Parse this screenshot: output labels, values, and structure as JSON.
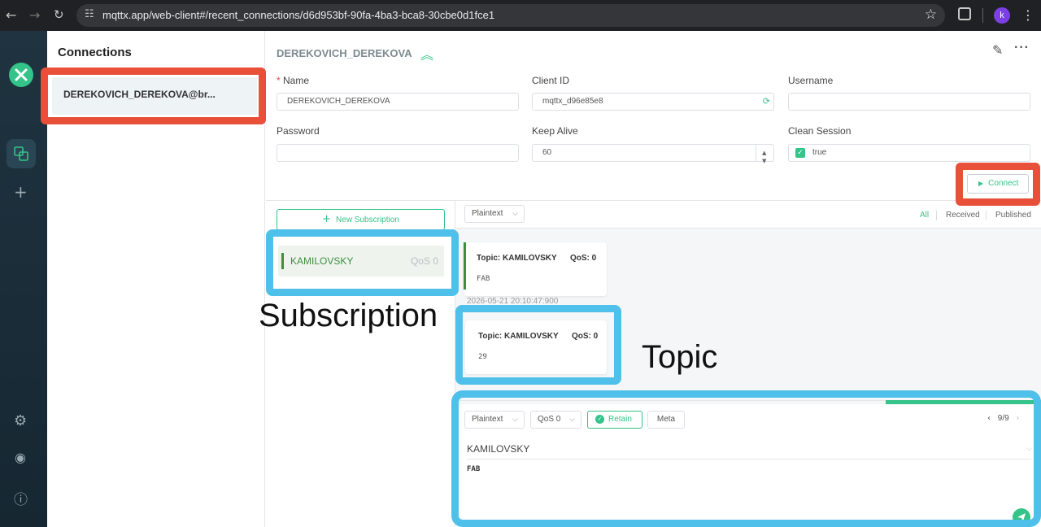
{
  "browser": {
    "url": "mqttx.app/web-client#/recent_connections/d6d953bf-90fa-4ba3-bca8-30cbe0d1fce1",
    "profile_initial": "k"
  },
  "sidebar": {
    "title": "Connections",
    "connection_item": "DEREKOVICH_DEREKOVA@br..."
  },
  "connection": {
    "header": "DEREKOVICH_DEREKOVA",
    "fields": {
      "name_label": "Name",
      "name_required_mark": "*",
      "name_value": "DEREKOVICH_DEREKOVA",
      "client_id_label": "Client ID",
      "client_id_value": "mqttx_d96e85e8",
      "username_label": "Username",
      "username_value": "",
      "password_label": "Password",
      "password_value": "",
      "keep_alive_label": "Keep Alive",
      "keep_alive_value": "60",
      "clean_session_label": "Clean Session",
      "clean_session_value": "true"
    },
    "connect_label": "Connect"
  },
  "subscriptions": {
    "new_label": "New Subscription",
    "items": [
      {
        "topic": "KAMILOVSKY",
        "qos": "QoS 0"
      }
    ]
  },
  "messages": {
    "format": "Plaintext",
    "filters": [
      "All",
      "Received",
      "Published"
    ],
    "active_filter": "All",
    "items": [
      {
        "topic": "Topic: KAMILOVSKY",
        "qos": "QoS: 0",
        "payload": "FAB",
        "time": "2026-05-21 20:10:47:900"
      },
      {
        "topic": "Topic: KAMILOVSKY",
        "qos": "QoS: 0",
        "payload": "29"
      }
    ]
  },
  "publish": {
    "format": "Plaintext",
    "qos": "QoS 0",
    "retain_label": "Retain",
    "meta_label": "Meta",
    "pager": "9/9",
    "topic": "KAMILOVSKY",
    "payload": "FAB"
  },
  "annotations": {
    "subscription_label": "Subscription",
    "topic_label": "Topic"
  },
  "colors": {
    "accent": "#34c388",
    "annotation_red": "#e8503a",
    "annotation_blue": "#4fc0ea",
    "rail_bg": "#1f3340"
  },
  "icons": [
    "back-icon",
    "forward-icon",
    "reload-icon",
    "site-settings-icon",
    "star-icon",
    "extensions-icon",
    "menu-icon",
    "logo-icon",
    "connections-icon",
    "add-icon",
    "settings-icon",
    "feed-icon",
    "info-icon",
    "collapse-icon",
    "edit-icon",
    "more-icon",
    "refresh-icon",
    "send-icon"
  ]
}
